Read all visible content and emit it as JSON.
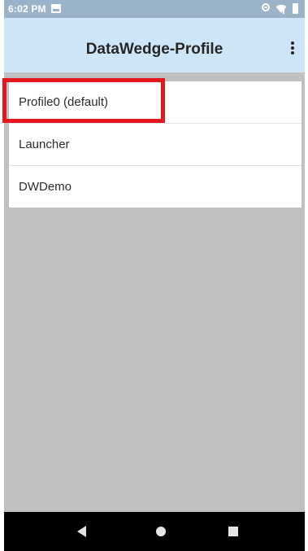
{
  "status_bar": {
    "time": "6:02 PM",
    "icons": [
      "notification-icon",
      "do-not-disturb-icon",
      "wifi-icon",
      "battery-icon"
    ]
  },
  "app_bar": {
    "title": "DataWedge-Profile",
    "menu_icon": "overflow-menu-icon"
  },
  "profiles": [
    {
      "label": "Profile0 (default)",
      "highlighted": true
    },
    {
      "label": "Launcher"
    },
    {
      "label": "DWDemo"
    }
  ],
  "nav_bar": {
    "icons": [
      "back-icon",
      "home-icon",
      "recents-icon"
    ]
  },
  "colors": {
    "status_bar": "#9ab3c9",
    "app_bar": "#cde5f7",
    "content_bg": "#c0c0c0",
    "highlight": "#e5161d",
    "nav_bar": "#000000"
  }
}
